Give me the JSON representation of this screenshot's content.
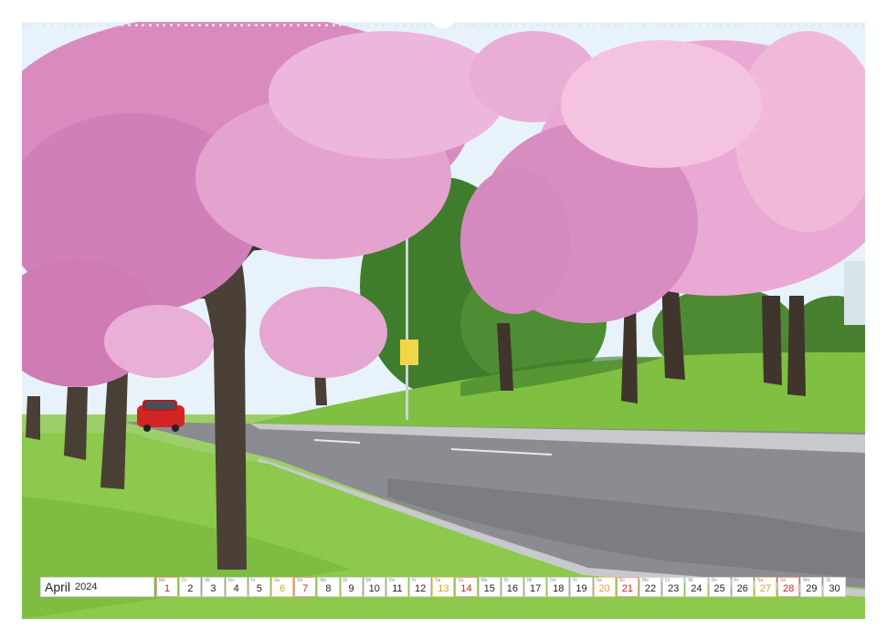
{
  "calendar": {
    "month": "April",
    "year": "2024",
    "weekday_abbr": [
      "Mo",
      "Di",
      "Mi",
      "Do",
      "Fr",
      "Sa",
      "So"
    ],
    "days": [
      {
        "day": "Mo",
        "num": "1",
        "type": "sun"
      },
      {
        "day": "Di",
        "num": "2",
        "type": "week"
      },
      {
        "day": "Mi",
        "num": "3",
        "type": "week"
      },
      {
        "day": "Do",
        "num": "4",
        "type": "week"
      },
      {
        "day": "Fr",
        "num": "5",
        "type": "week"
      },
      {
        "day": "Sa",
        "num": "6",
        "type": "sat"
      },
      {
        "day": "So",
        "num": "7",
        "type": "sun"
      },
      {
        "day": "Mo",
        "num": "8",
        "type": "week"
      },
      {
        "day": "Di",
        "num": "9",
        "type": "week"
      },
      {
        "day": "Mi",
        "num": "10",
        "type": "week"
      },
      {
        "day": "Do",
        "num": "11",
        "type": "week"
      },
      {
        "day": "Fr",
        "num": "12",
        "type": "week"
      },
      {
        "day": "Sa",
        "num": "13",
        "type": "sat"
      },
      {
        "day": "So",
        "num": "14",
        "type": "sun"
      },
      {
        "day": "Mo",
        "num": "15",
        "type": "week"
      },
      {
        "day": "Di",
        "num": "16",
        "type": "week"
      },
      {
        "day": "Mi",
        "num": "17",
        "type": "week"
      },
      {
        "day": "Do",
        "num": "18",
        "type": "week"
      },
      {
        "day": "Fr",
        "num": "19",
        "type": "week"
      },
      {
        "day": "Sa",
        "num": "20",
        "type": "sat"
      },
      {
        "day": "So",
        "num": "21",
        "type": "sun"
      },
      {
        "day": "Mo",
        "num": "22",
        "type": "week"
      },
      {
        "day": "Di",
        "num": "23",
        "type": "week"
      },
      {
        "day": "Mi",
        "num": "24",
        "type": "week"
      },
      {
        "day": "Do",
        "num": "25",
        "type": "week"
      },
      {
        "day": "Fr",
        "num": "26",
        "type": "week"
      },
      {
        "day": "Sa",
        "num": "27",
        "type": "sat"
      },
      {
        "day": "So",
        "num": "28",
        "type": "sun"
      },
      {
        "day": "Mo",
        "num": "29",
        "type": "week"
      },
      {
        "day": "Di",
        "num": "30",
        "type": "week"
      }
    ]
  },
  "colors": {
    "blossom": "#d98bc0",
    "blossom_light": "#f0b9da",
    "grass": "#8cc94c",
    "road": "#8a8c91",
    "sky": "#e8f2fb",
    "saturday": "#e0a020",
    "sunday": "#c0262a"
  },
  "scene": {
    "description_icon": "cherry-blossom-avenue-photo",
    "sign_icon": "road-sign-icon"
  }
}
